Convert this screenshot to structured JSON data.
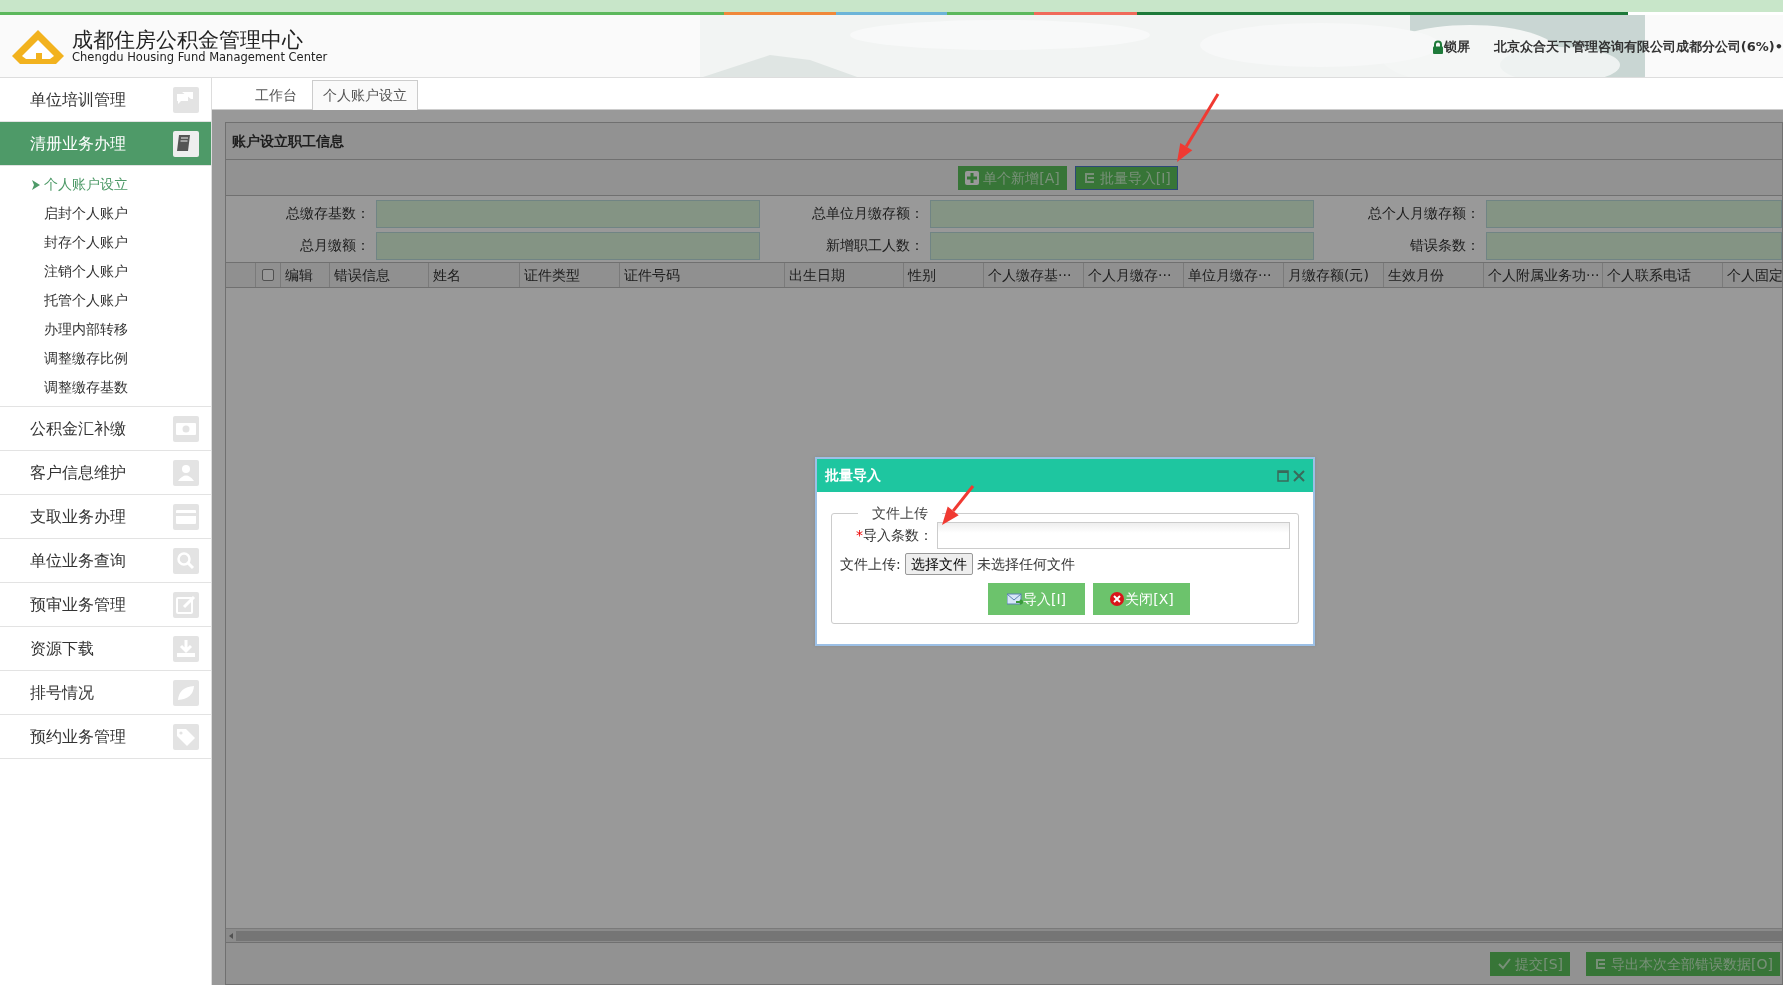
{
  "header": {
    "title": "成都住房公积金管理中心",
    "subtitle": "Chengdu  Housing Fund Management Center",
    "lock_label": "锁屏",
    "company": "北京众合天下管理咨询有限公司成都分公司(6%)•"
  },
  "sidebar": {
    "items": [
      {
        "label": "单位培训管理",
        "selected": false
      },
      {
        "label": "清册业务办理",
        "selected": true,
        "children": [
          {
            "label": "个人账户设立",
            "selected": true
          },
          {
            "label": "启封个人账户",
            "selected": false
          },
          {
            "label": "封存个人账户",
            "selected": false
          },
          {
            "label": "注销个人账户",
            "selected": false
          },
          {
            "label": "托管个人账户",
            "selected": false
          },
          {
            "label": "办理内部转移",
            "selected": false
          },
          {
            "label": "调整缴存比例",
            "selected": false
          },
          {
            "label": "调整缴存基数",
            "selected": false
          }
        ]
      },
      {
        "label": "公积金汇补缴",
        "selected": false
      },
      {
        "label": "客户信息维护",
        "selected": false
      },
      {
        "label": "支取业务办理",
        "selected": false
      },
      {
        "label": "单位业务查询",
        "selected": false
      },
      {
        "label": "预审业务管理",
        "selected": false
      },
      {
        "label": "资源下载",
        "selected": false
      },
      {
        "label": "排号情况",
        "selected": false
      },
      {
        "label": "预约业务管理",
        "selected": false
      }
    ]
  },
  "tabs": [
    {
      "label": "工作台",
      "selected": false
    },
    {
      "label": "个人账户设立",
      "selected": true
    }
  ],
  "panel": {
    "title": "账户设立职工信息",
    "toolbar": [
      {
        "label": "单个新增[A]",
        "kind": "add",
        "focused": false
      },
      {
        "label": "批量导入[I]",
        "kind": "import",
        "focused": true
      }
    ],
    "fields": [
      {
        "label": "总缴存基数："
      },
      {
        "label": "总单位月缴存额："
      },
      {
        "label": "总个人月缴存额："
      },
      {
        "label": "总月缴额："
      },
      {
        "label": "新增职工人数："
      },
      {
        "label": "错误条数："
      }
    ],
    "table": {
      "select_all_checked": false,
      "columns": [
        "编辑",
        "错误信息",
        "姓名",
        "证件类型",
        "证件号码",
        "出生日期",
        "性别",
        "个人缴存基···",
        "个人月缴存···",
        "单位月缴存···",
        "月缴存额(元)",
        "生效月份",
        "个人附属业务功···",
        "个人联系电话",
        "个人固定"
      ]
    },
    "footer": [
      {
        "label": "提交[S]",
        "kind": "submit"
      },
      {
        "label": "导出本次全部错误数据[O]",
        "kind": "export"
      }
    ]
  },
  "dialog": {
    "title": "批量导入",
    "legend": "文件上传",
    "required_mark": "*",
    "count_label": "导入条数：",
    "file_label": "文件上传:",
    "file_button": "选择文件",
    "file_status": "未选择任何文件",
    "buttons": [
      {
        "label": "导入[I]",
        "kind": "import"
      },
      {
        "label": "关闭[X]",
        "kind": "close"
      }
    ]
  }
}
